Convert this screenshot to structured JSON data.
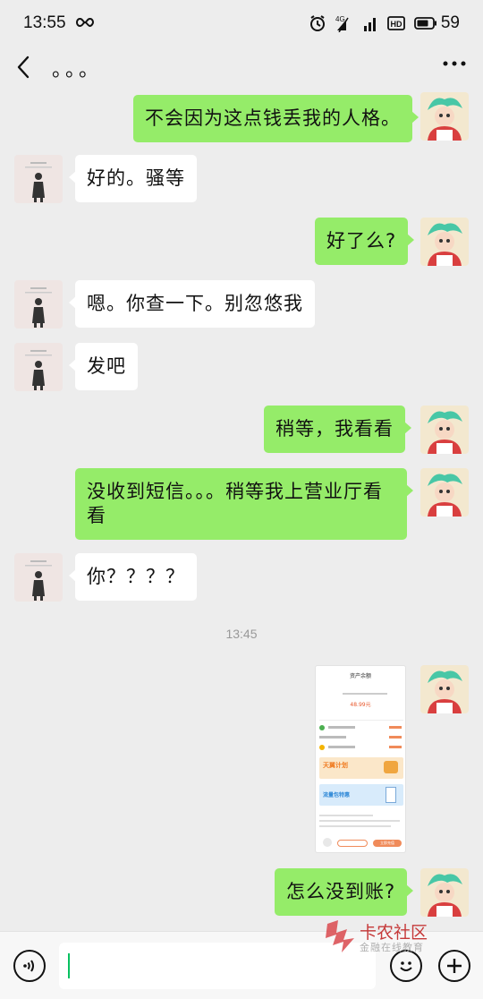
{
  "status_bar": {
    "time": "13:55",
    "battery": "59",
    "network": "4G",
    "hd": "HD"
  },
  "header": {
    "title": "。。。"
  },
  "messages": [
    {
      "side": "me",
      "text": "不会因为这点钱丢我的人格。"
    },
    {
      "side": "other",
      "text": "好的。骚等"
    },
    {
      "side": "me",
      "text": "好了么?"
    },
    {
      "side": "other",
      "text": "嗯。你查一下。别忽悠我"
    },
    {
      "side": "other",
      "text": "发吧"
    },
    {
      "side": "me",
      "text": "稍等，我看看"
    },
    {
      "side": "me",
      "text": "没收到短信。。。稍等我上营业厅看看"
    },
    {
      "side": "other",
      "text": "你？？？？"
    },
    {
      "side": "me",
      "text": "怎么没到账?"
    }
  ],
  "time_divider": "13:45",
  "screenshot_thumb": {
    "title": "资产余额",
    "amount": "48.99元",
    "banner1": "天翼计划",
    "banner2": "流量包特惠",
    "btn": "立即充值"
  },
  "watermark": {
    "name": "卡农社区",
    "slogan": "金融在线教育"
  },
  "colors": {
    "my_bubble": "#95ec69",
    "other_bubble": "#ffffff",
    "background": "#ededed"
  }
}
